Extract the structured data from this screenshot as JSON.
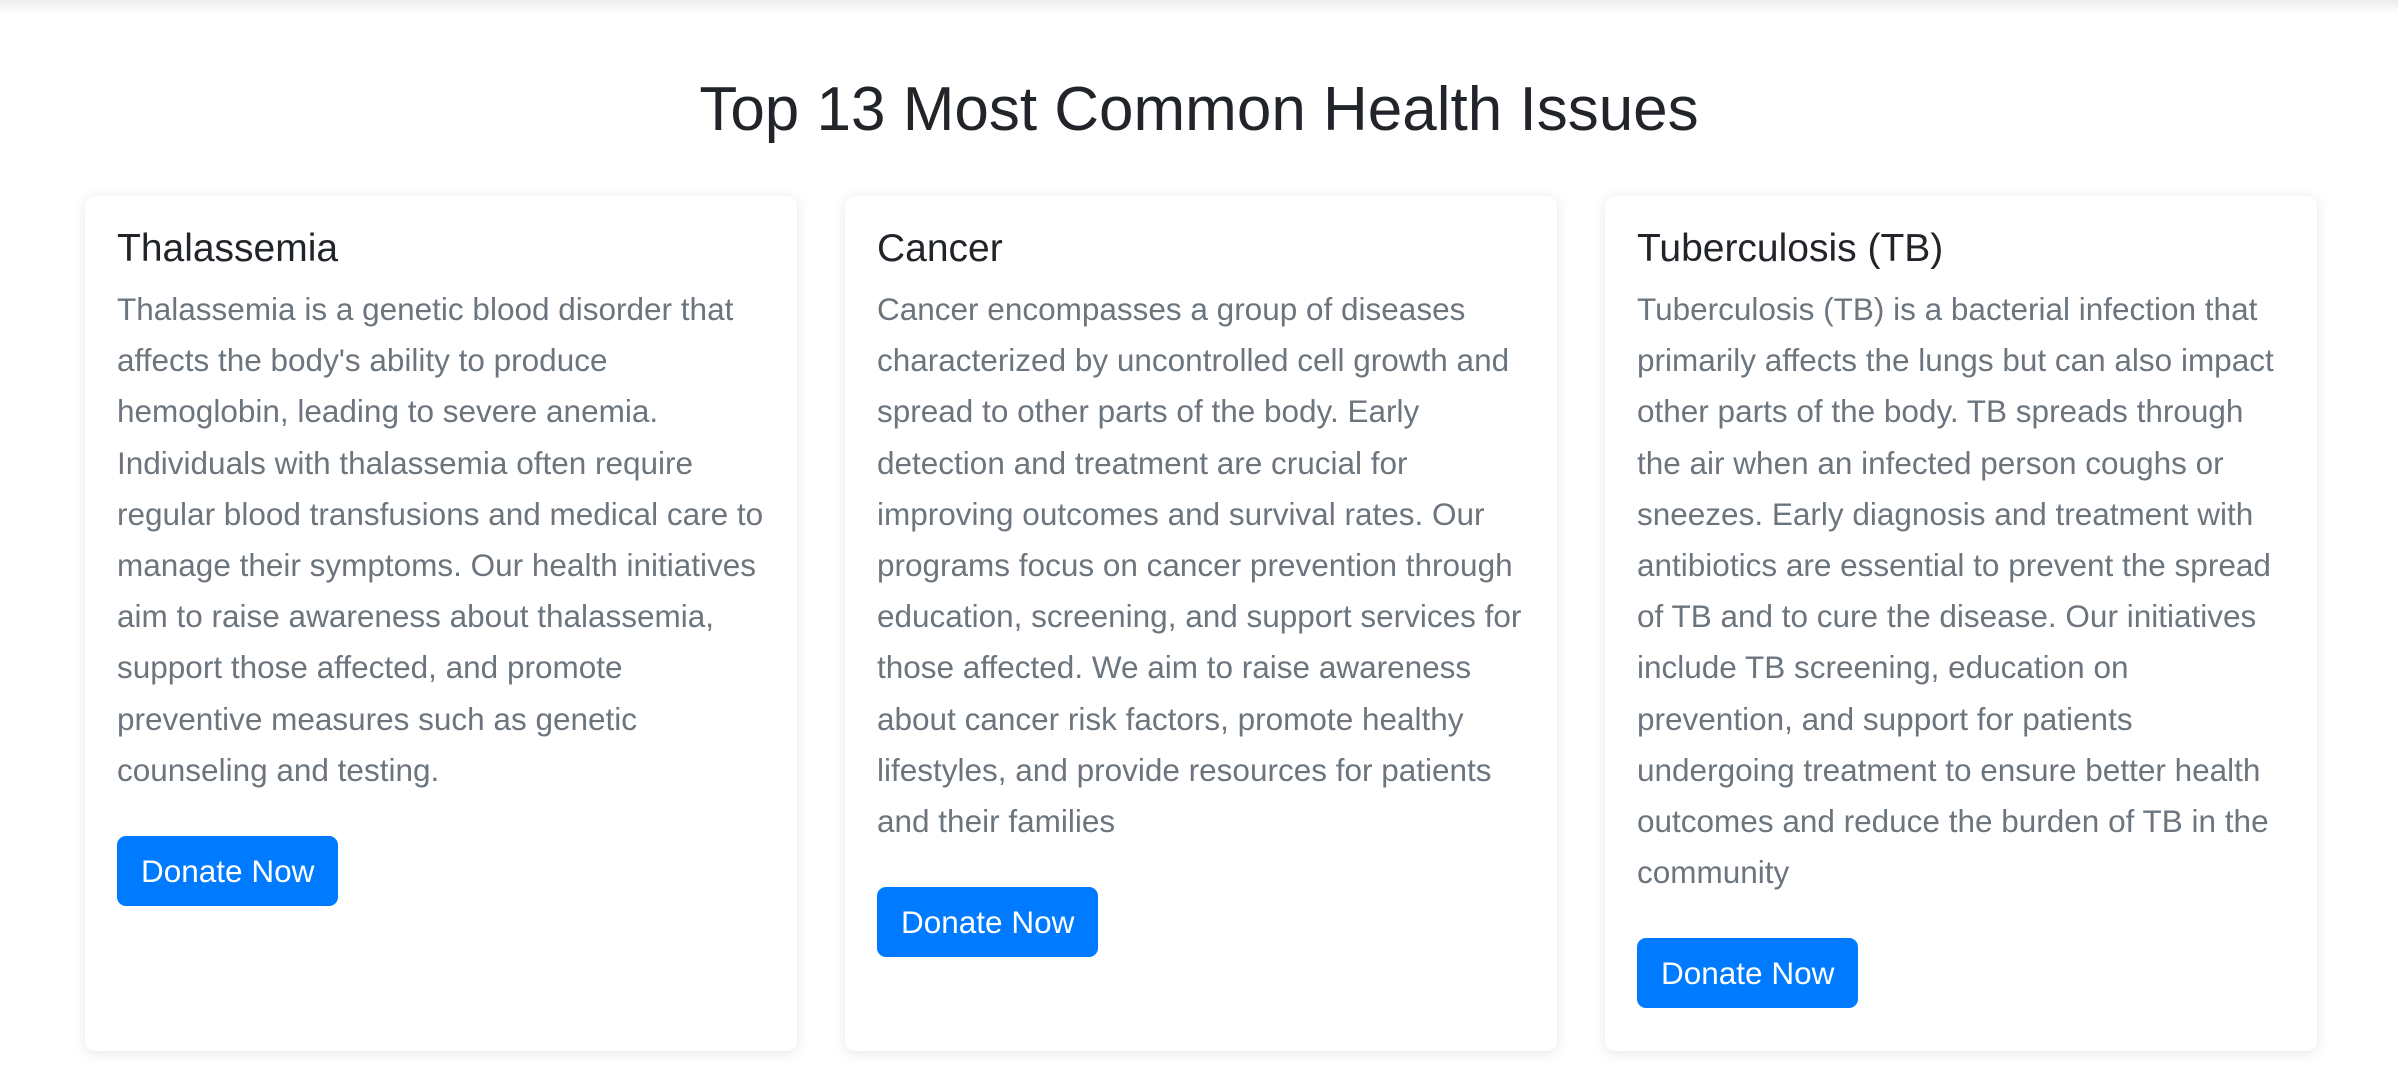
{
  "page": {
    "title": "Top 13 Most Common Health Issues"
  },
  "cards": [
    {
      "title": "Thalassemia",
      "text": "Thalassemia is a genetic blood disorder that affects the body's ability to produce hemoglobin, leading to severe anemia. Individuals with thalassemia often require regular blood transfusions and medical care to manage their symptoms. Our health initiatives aim to raise awareness about thalassemia, support those affected, and promote preventive measures such as genetic counseling and testing.",
      "button_label": "Donate Now"
    },
    {
      "title": "Cancer",
      "text": "Cancer encompasses a group of diseases characterized by uncontrolled cell growth and spread to other parts of the body. Early detection and treatment are crucial for improving outcomes and survival rates. Our programs focus on cancer prevention through education, screening, and support services for those affected. We aim to raise awareness about cancer risk factors, promote healthy lifestyles, and provide resources for patients and their families",
      "button_label": "Donate Now"
    },
    {
      "title": "Tuberculosis (TB)",
      "text": "Tuberculosis (TB) is a bacterial infection that primarily affects the lungs but can also impact other parts of the body. TB spreads through the air when an infected person coughs or sneezes. Early diagnosis and treatment with antibiotics are essential to prevent the spread of TB and to cure the disease. Our initiatives include TB screening, education on prevention, and support for patients undergoing treatment to ensure better health outcomes and reduce the burden of TB in the community",
      "button_label": "Donate Now"
    }
  ],
  "colors": {
    "accent": "#007bff",
    "heading": "#212529",
    "body_text": "#6c757d"
  }
}
